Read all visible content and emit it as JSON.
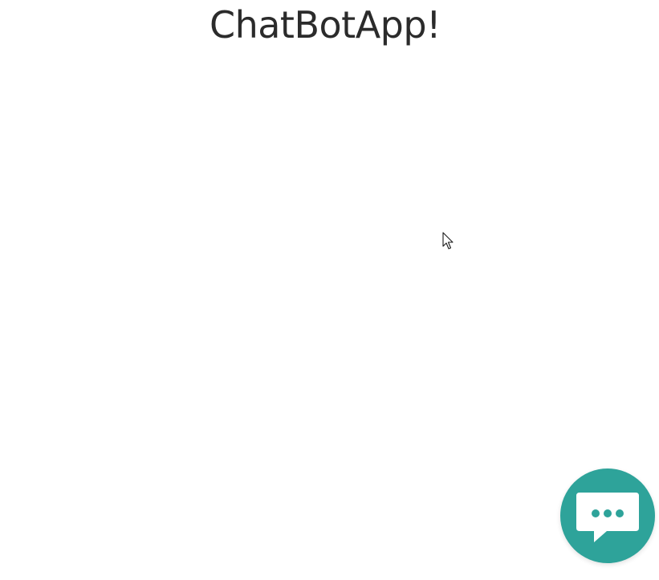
{
  "page": {
    "title": "ChatBotApp!"
  },
  "chat_launcher": {
    "icon": "chat-bubble-icon",
    "color": "#2ea39a"
  },
  "cursor": {
    "icon": "mouse-pointer-icon"
  }
}
